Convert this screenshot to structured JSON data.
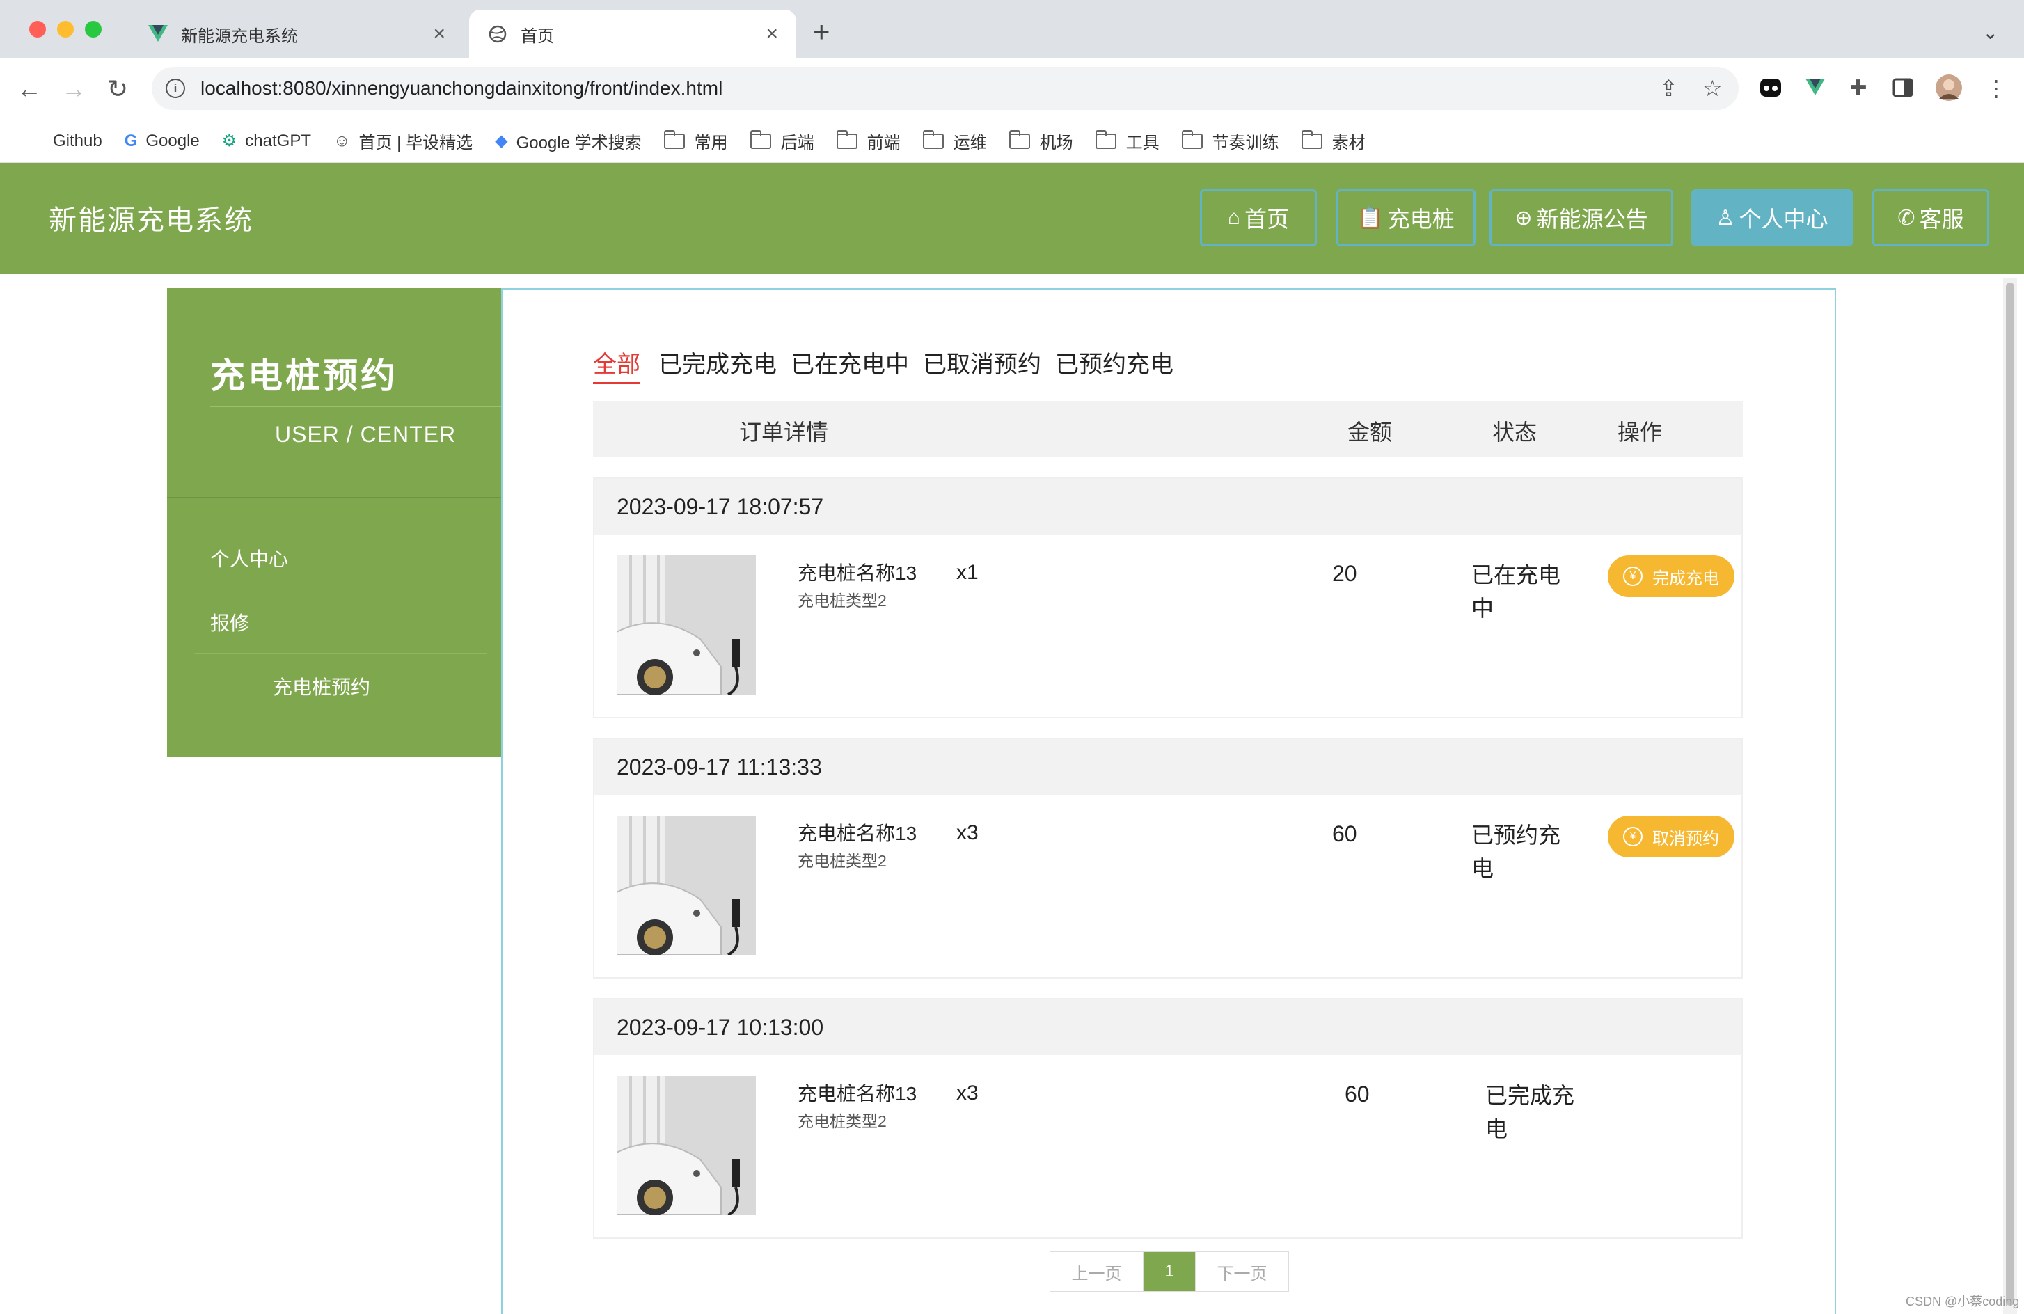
{
  "browser": {
    "tabs": [
      {
        "title": "新能源充电系统",
        "active": false
      },
      {
        "title": "首页",
        "active": true
      }
    ],
    "url": "localhost:8080/xinnengyuanchongdainxitong/front/index.html",
    "bookmarks": [
      {
        "label": "Github",
        "icon": "github-icon"
      },
      {
        "label": "Google",
        "icon": "google-icon"
      },
      {
        "label": "chatGPT",
        "icon": "chatgpt-icon"
      },
      {
        "label": "首页 | 毕设精选",
        "icon": "avatar-icon"
      },
      {
        "label": "Google 学术搜索",
        "icon": "scholar-icon"
      },
      {
        "label": "常用",
        "icon": "folder-icon"
      },
      {
        "label": "后端",
        "icon": "folder-icon"
      },
      {
        "label": "前端",
        "icon": "folder-icon"
      },
      {
        "label": "运维",
        "icon": "folder-icon"
      },
      {
        "label": "机场",
        "icon": "folder-icon"
      },
      {
        "label": "工具",
        "icon": "folder-icon"
      },
      {
        "label": "节奏训练",
        "icon": "folder-icon"
      },
      {
        "label": "素材",
        "icon": "folder-icon"
      }
    ]
  },
  "header": {
    "site_title": "新能源充电系统",
    "nav": [
      {
        "label": "首页",
        "icon": "home-icon",
        "active": false
      },
      {
        "label": "充电桩",
        "icon": "clipboard-icon",
        "active": false
      },
      {
        "label": "新能源公告",
        "icon": "globe-icon",
        "active": false
      },
      {
        "label": "个人中心",
        "icon": "user-icon",
        "active": true
      },
      {
        "label": "客服",
        "icon": "wechat-icon",
        "active": false
      }
    ],
    "accent_color": "#7fa84e",
    "active_color": "#62b4c4"
  },
  "sidebar": {
    "title": "充电桩预约",
    "subtitle": "USER / CENTER",
    "items": [
      {
        "label": "个人中心"
      },
      {
        "label": "报修"
      },
      {
        "label": "充电桩预约"
      }
    ]
  },
  "orders": {
    "filter_tabs": [
      {
        "label": "全部",
        "active": true
      },
      {
        "label": "已完成充电",
        "active": false
      },
      {
        "label": "已在充电中",
        "active": false
      },
      {
        "label": "已取消预约",
        "active": false
      },
      {
        "label": "已预约充电",
        "active": false
      }
    ],
    "columns": [
      "订单详情",
      "金额",
      "状态",
      "操作"
    ],
    "list": [
      {
        "time": "2023-09-17 18:07:57",
        "name": "充电桩名称13",
        "type": "充电桩类型2",
        "qty": "x1",
        "amount": "20",
        "status": "已在充电中",
        "action": "完成充电"
      },
      {
        "time": "2023-09-17 11:13:33",
        "name": "充电桩名称13",
        "type": "充电桩类型2",
        "qty": "x3",
        "amount": "60",
        "status": "已预约充电",
        "action": "取消预约"
      },
      {
        "time": "2023-09-17 10:13:00",
        "name": "充电桩名称13",
        "type": "充电桩类型2",
        "qty": "x3",
        "amount": "60",
        "status": "已完成充电",
        "action": ""
      }
    ],
    "action_color": "#f6b731"
  },
  "pagination": {
    "prev": "上一页",
    "current": "1",
    "next": "下一页"
  },
  "watermark": "CSDN @小蔡coding"
}
